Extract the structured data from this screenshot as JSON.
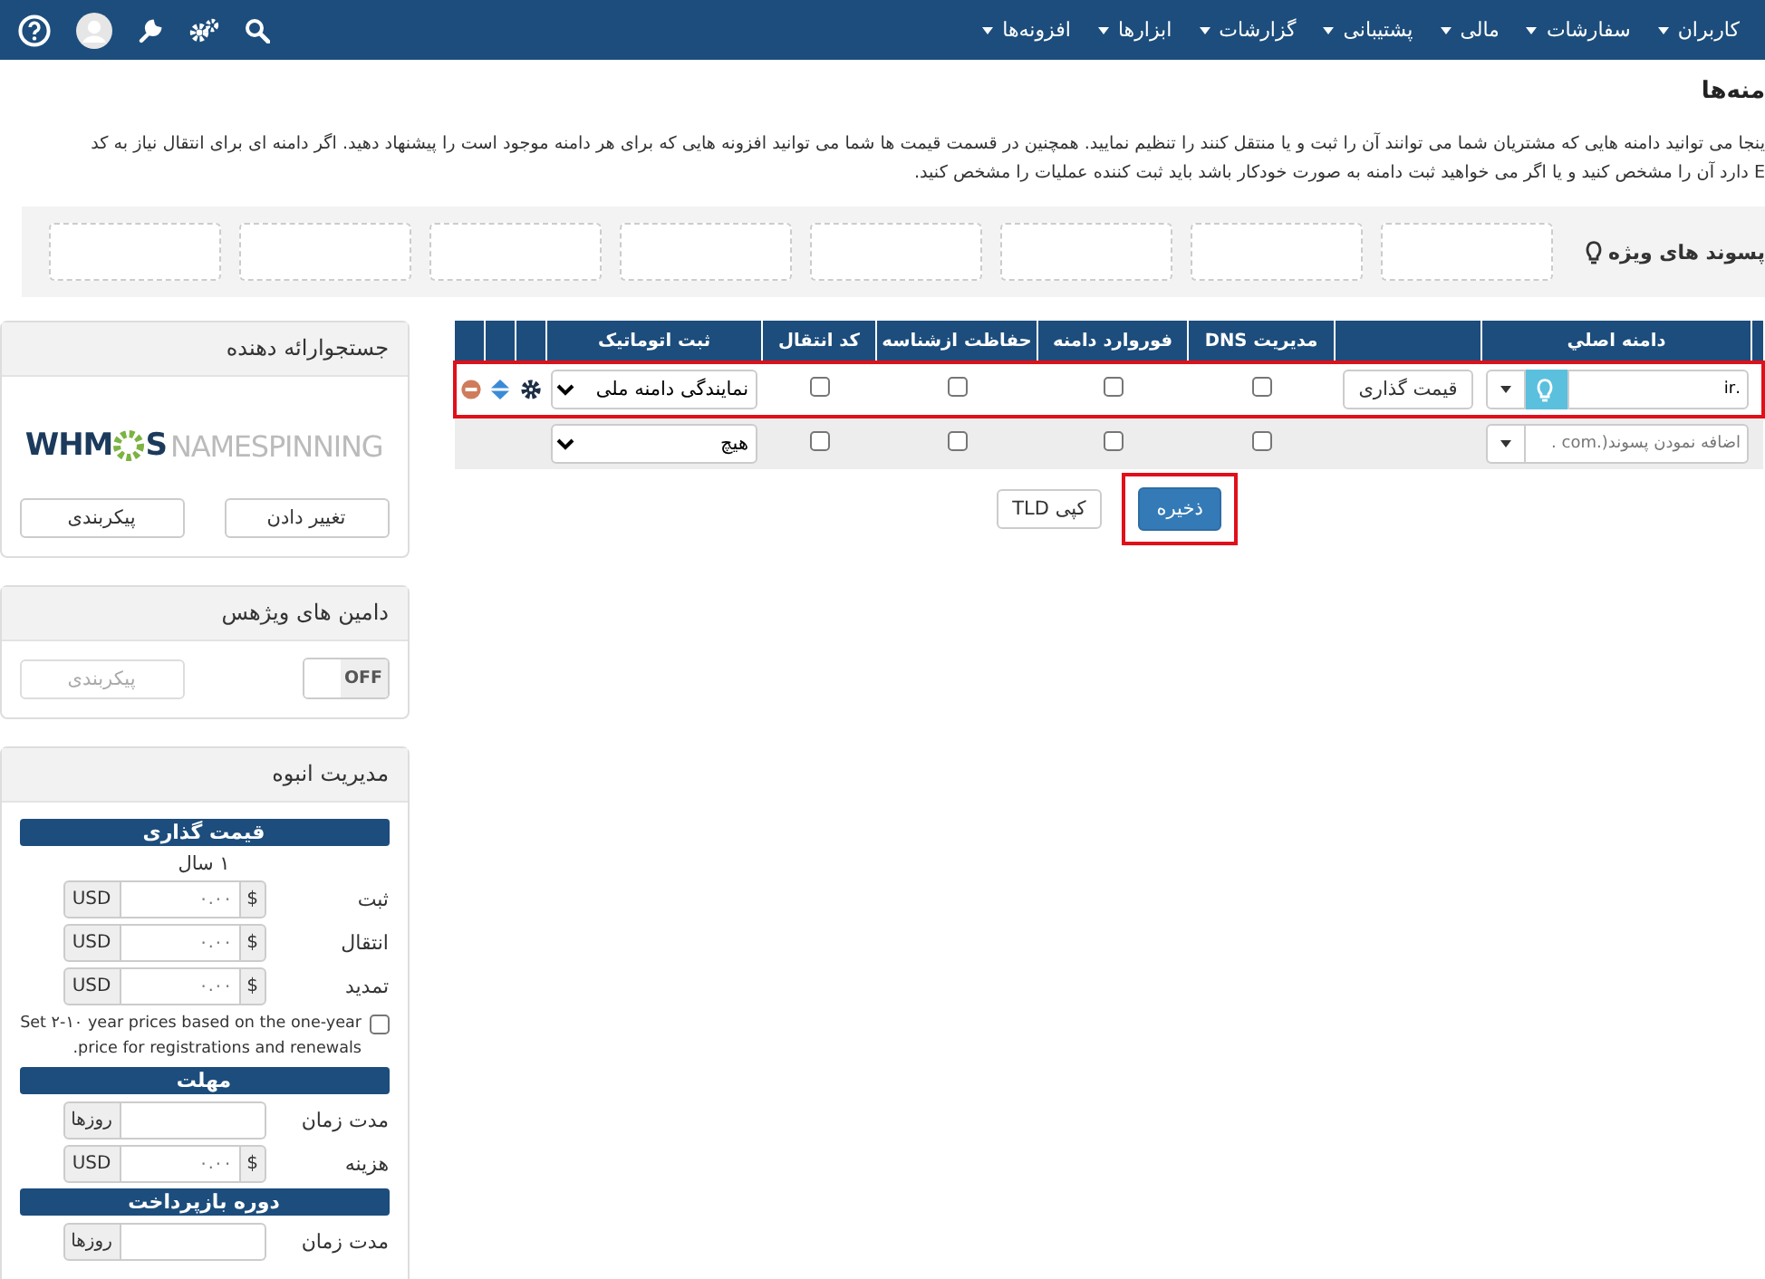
{
  "navbar": {
    "menus": [
      {
        "label": "کاربران"
      },
      {
        "label": "سفارشات"
      },
      {
        "label": "مالی"
      },
      {
        "label": "پشتیبانی"
      },
      {
        "label": "گزارشات"
      },
      {
        "label": "ابزارها"
      },
      {
        "label": "افزونه‌ها"
      }
    ]
  },
  "page": {
    "title": "منه‌ها",
    "description": [
      "ینجا می توانید دامنه هایی که مشتریان شما می توانند آن را ثبت و یا منتقل کنند را تنظیم نمایید. همچنین در قسمت قیمت ها شما می توانید افزونه هایی که برای هر دامنه موجود است را پیشنهاد دهید. اگر دامنه ای برای انتقال نیاز به کد",
      "E دارد آن را مشخص کنید و یا اگر می خواهید ثبت دامنه به صورت خودکار باشد باید ثبت کننده عملیات را مشخص کنید."
    ]
  },
  "featured_tlds": {
    "label": "پسوند های ویژه",
    "slots": [
      {
        "kind": "empty"
      },
      {
        "kind": "empty"
      },
      {
        "kind": "empty"
      },
      {
        "kind": "empty"
      },
      {
        "kind": "empty"
      },
      {
        "kind": "empty"
      },
      {
        "kind": "empty"
      },
      {
        "kind": "empty"
      }
    ]
  },
  "table": {
    "columns": [
      {
        "kind": "edge"
      },
      {
        "kind": "text",
        "label": "دامنه اصلي"
      },
      {
        "kind": "blank"
      },
      {
        "kind": "text",
        "label": "مدیریت DNS"
      },
      {
        "kind": "text",
        "label": "فوروارد دامنه"
      },
      {
        "kind": "text",
        "label": "حفاظت ازشناسه"
      },
      {
        "kind": "text",
        "label": "کد انتقال"
      },
      {
        "kind": "text",
        "label": "ثبت اتوماتیک"
      },
      {
        "kind": "blank"
      },
      {
        "kind": "blank"
      },
      {
        "kind": "blank"
      }
    ],
    "rows": [
      {
        "kind": "existing",
        "highlighted": true,
        "tld": ".ir",
        "pricing_button": "قیمت گذاری",
        "dns": false,
        "forwarding": false,
        "id_protection": false,
        "epp_code": false,
        "auto_register": "نمایندگی دامنه ملی"
      },
      {
        "kind": "new",
        "highlighted": false,
        "placeholder": "اضافه نمودن پسوند(.com .",
        "dns": false,
        "forwarding": false,
        "id_protection": false,
        "epp_code": false,
        "auto_register": "هیچ"
      }
    ]
  },
  "actions": {
    "save": {
      "label": "ذخیره",
      "highlighted": true
    },
    "copy": {
      "label": "کپی TLD",
      "highlighted": false
    }
  },
  "sidebar": {
    "panels": [
      {
        "kind": "spinner",
        "title": "جستجوارائه دهنده",
        "logo": {
          "lead": "WHM",
          "end": "S",
          "tail": "NAMESPINNING"
        },
        "buttons": [
          {
            "label": "تغییر دادن",
            "disabled": false
          },
          {
            "label": "پیکربندی",
            "disabled": false
          }
        ]
      },
      {
        "kind": "premium",
        "title": "دامین های ویژهس",
        "toggle": {
          "label": "OFF",
          "on": false
        },
        "button": {
          "label": "پیکربندی",
          "disabled": true
        }
      },
      {
        "kind": "bulk",
        "title": "مدیریت انبوه",
        "sections": [
          {
            "heading": "قیمت گذاری",
            "subheading": "۱ سال",
            "fields": [
              {
                "kind": "price",
                "label": "ثبت",
                "prefix": "$",
                "placeholder": "۰.۰۰",
                "suffix": "USD"
              },
              {
                "kind": "price",
                "label": "انتقال",
                "prefix": "$",
                "placeholder": "۰.۰۰",
                "suffix": "USD"
              },
              {
                "kind": "price",
                "label": "تمدید",
                "prefix": "$",
                "placeholder": "۰.۰۰",
                "suffix": "USD"
              }
            ],
            "checkbox": {
              "label": "Set ۲-۱۰ year prices based on the one-year price for registrations and renewals.",
              "checked": false
            }
          },
          {
            "heading": "مهلت",
            "fields": [
              {
                "kind": "days",
                "label": "مدت زمان",
                "suffix": "روزها"
              },
              {
                "kind": "price",
                "label": "هزینه",
                "prefix": "$",
                "placeholder": "۰.۰۰",
                "suffix": "USD"
              }
            ]
          },
          {
            "heading": "دوره بازپرداخت",
            "fields": [
              {
                "kind": "days",
                "label": "مدت زمان",
                "suffix": "روزها"
              }
            ]
          }
        ]
      }
    ]
  }
}
